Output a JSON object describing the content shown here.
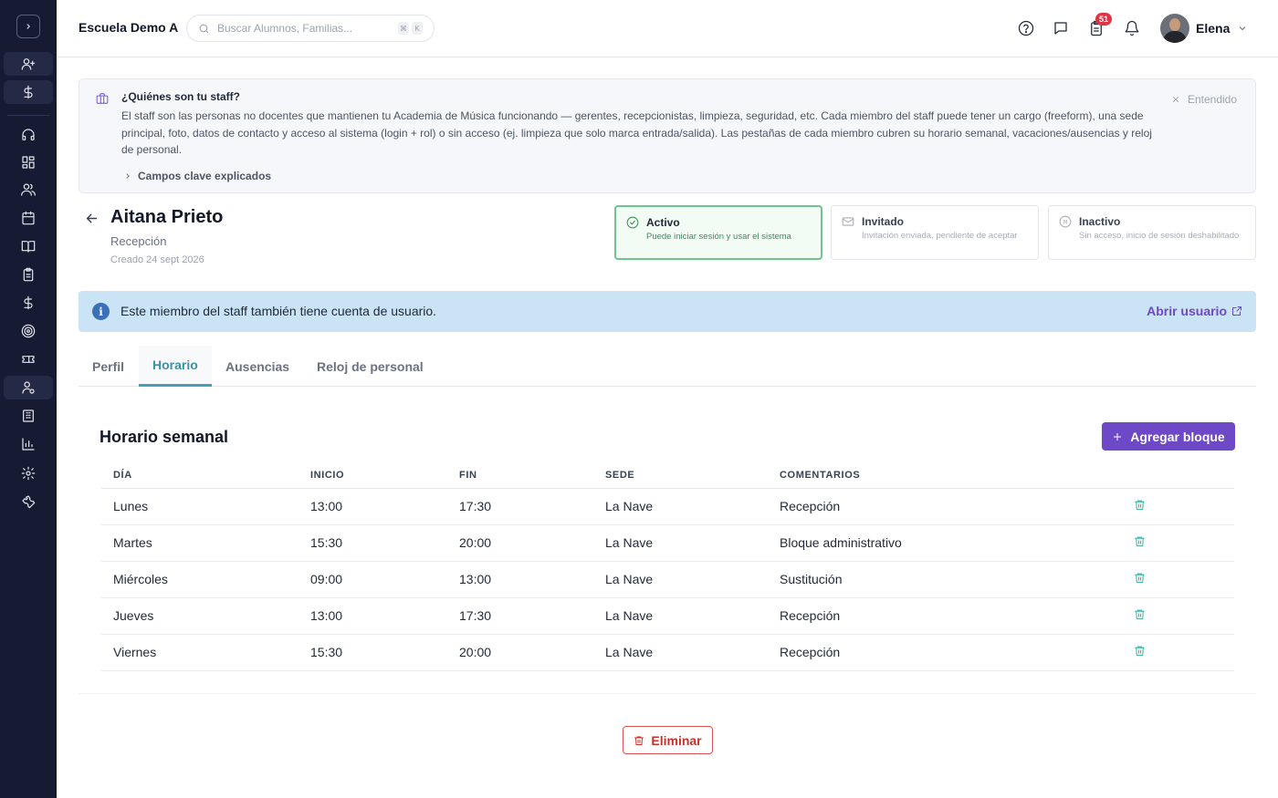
{
  "header": {
    "school_name": "Escuela Demo A",
    "search_placeholder": "Buscar Alumnos, Familias...",
    "shortcut_keys": [
      "⌘",
      "K"
    ],
    "notifications_count": "51",
    "user_name": "Elena"
  },
  "sidebar": {
    "icons": [
      "chevron-right-icon",
      "user-plus-icon",
      "dollar-icon",
      "headset-icon",
      "dashboard-icon",
      "users-icon",
      "calendar-icon",
      "book-icon",
      "clipboard-icon",
      "dollar-icon",
      "target-icon",
      "ticket-icon",
      "staff-icon",
      "building-icon",
      "chart-icon",
      "settings-icon",
      "wrench-icon"
    ],
    "active_item": "staff-icon"
  },
  "info_card": {
    "title": "¿Quiénes son tu staff?",
    "body": "El staff son las personas no docentes que mantienen tu Academia de Música funcionando — gerentes, recepcionistas, limpieza, seguridad, etc. Cada miembro del staff puede tener un cargo (freeform), una sede principal, foto, datos de contacto y acceso al sistema (login + rol) o sin acceso (ej. limpieza que solo marca entrada/salida). Las pestañas de cada miembro cubren su horario semanal, vacaciones/ausencias y reloj de personal.",
    "link_label": "Campos clave explicados",
    "dismiss_label": "Entendido"
  },
  "staff": {
    "name": "Aitana Prieto",
    "role": "Recepción",
    "created": "Creado 24 sept 2026"
  },
  "status_cards": [
    {
      "title": "Activo",
      "description": "Puede iniciar sesión y usar el sistema",
      "selected": true
    },
    {
      "title": "Invitado",
      "description": "Invitación enviada, pendiente de aceptar",
      "selected": false
    },
    {
      "title": "Inactivo",
      "description": "Sin acceso, inicio de sesión deshabilitado",
      "selected": false
    }
  ],
  "alert": {
    "text": "Este miembro del staff también tiene cuenta de usuario.",
    "link_label": "Abrir usuario"
  },
  "tabs": [
    {
      "label": "Perfil",
      "active": false
    },
    {
      "label": "Horario",
      "active": true
    },
    {
      "label": "Ausencias",
      "active": false
    },
    {
      "label": "Reloj de personal",
      "active": false
    }
  ],
  "schedule": {
    "title": "Horario semanal",
    "add_button_label": "Agregar bloque",
    "columns": [
      "DÍA",
      "INICIO",
      "FIN",
      "SEDE",
      "COMENTARIOS"
    ],
    "rows": [
      {
        "day": "Lunes",
        "start": "13:00",
        "end": "17:30",
        "location": "La Nave",
        "comment": "Recepción"
      },
      {
        "day": "Martes",
        "start": "15:30",
        "end": "20:00",
        "location": "La Nave",
        "comment": "Bloque administrativo"
      },
      {
        "day": "Miércoles",
        "start": "09:00",
        "end": "13:00",
        "location": "La Nave",
        "comment": "Sustitución"
      },
      {
        "day": "Jueves",
        "start": "13:00",
        "end": "17:30",
        "location": "La Nave",
        "comment": "Recepción"
      },
      {
        "day": "Viernes",
        "start": "15:30",
        "end": "20:00",
        "location": "La Nave",
        "comment": "Recepción"
      }
    ]
  },
  "delete_button_label": "Eliminar",
  "colors": {
    "sidebar_bg": "#161a33",
    "primary": "#6d48c7",
    "active_tab": "#3d8fa8",
    "success": "#3e8e58",
    "danger": "#c9302c",
    "alert_bg": "#cbe4f5"
  }
}
